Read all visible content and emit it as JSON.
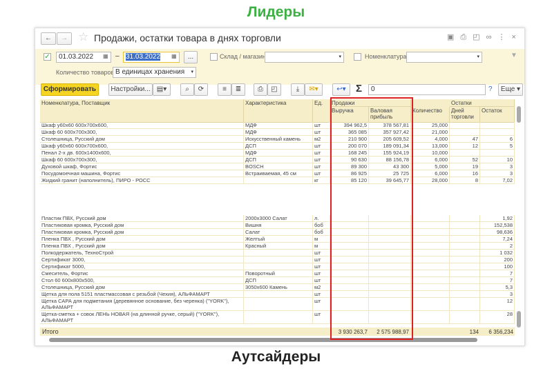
{
  "captions": {
    "top": "Лидеры",
    "bottom": "Аутсайдеры"
  },
  "window": {
    "title": "Продажи, остатки товара в днях торговли"
  },
  "filters": {
    "date_from": "01.03.2022",
    "date_sep": "–",
    "date_to": "31.03.2022",
    "dots": "...",
    "store_label": "Склад / магазин:",
    "nomen_label": "Номенклатура:",
    "qty_label": "Количество товаров:",
    "qty_value": "В единицах хранения"
  },
  "toolbar": {
    "generate": "Сформировать",
    "settings": "Настройки...",
    "sum_value": "0",
    "help": "?",
    "more": "Еще"
  },
  "headers": {
    "name": "Номенклатура, Поставщик",
    "char": "Характеристика",
    "unit": "Ед.",
    "sales": "Продажи",
    "revenue": "Выручка",
    "profit": "Валовая прибыль",
    "qty": "Количество",
    "stock": "Остатки",
    "days": "Дней торговли",
    "remain": "Остаток"
  },
  "leaders": [
    [
      "Шкаф у60х60 600х700х600,",
      "МДФ",
      "шт",
      "394 962,5",
      "378 567,81",
      "25,000",
      "",
      ""
    ],
    [
      "Шкаф 60 600х700х300,",
      "МДФ",
      "шт",
      "365 085",
      "357 927,42",
      "21,000",
      "",
      ""
    ],
    [
      "Столешница, Русский дом",
      "Искусственный камень",
      "м2",
      "210 900",
      "205 609,52",
      "4,000",
      "47",
      "6"
    ],
    [
      "Шкаф у60х60 600х700х600,",
      "ДСП",
      "шт",
      "200 070",
      "189 091,34",
      "13,000",
      "12",
      "5"
    ],
    [
      "Пенал 2-х дв. 600х1400х600,",
      "МДФ",
      "шт",
      "168 245",
      "155 924,19",
      "10,000",
      "",
      ""
    ],
    [
      "Шкаф 60 600х700х300,",
      "ДСП",
      "шт",
      "90 630",
      "88 156,78",
      "6,000",
      "52",
      "10"
    ],
    [
      "Духовой шкаф, Фортис",
      "BOSCH",
      "шт",
      "89 300",
      "43 300",
      "5,000",
      "19",
      "3"
    ],
    [
      "Посудомоечная машина, Фортис",
      "Встраиваемая, 45 см",
      "шт",
      "86 925",
      "25 725",
      "6,000",
      "16",
      "3"
    ],
    [
      "Жидкий гранит (наполнитель), ПИРО - РОСС",
      "",
      "кг",
      "85 120",
      "39 645,77",
      "28,000",
      "8",
      "7,02"
    ]
  ],
  "outsiders": [
    [
      "Пластик ПВХ, Русский дом",
      "2000х3000 Салат",
      "л.",
      "1,92"
    ],
    [
      "Пластиковая кромка, Русский дом",
      "Вишня",
      "боб",
      "152,538"
    ],
    [
      "Пластиковая кромка, Русский дом",
      "Салат",
      "боб",
      "98,636"
    ],
    [
      "Пленка ПВХ , Русский дом",
      "Желтый",
      "м",
      "7,24"
    ],
    [
      "Пленка ПВХ , Русский дом",
      "Красный",
      "м",
      "2"
    ],
    [
      "Полкодержатель, ТехноСтрой",
      "",
      "шт",
      "1 032"
    ],
    [
      "Сертификат 3000,",
      "",
      "шт",
      "200"
    ],
    [
      "Сертификат 5000,",
      "",
      "шт",
      "100"
    ],
    [
      "Смеситель, Фортис",
      "Поворотный",
      "шт",
      "7"
    ],
    [
      "Стол 60 600х800х500,",
      "ДСП",
      "шт",
      "7"
    ],
    [
      "Столешница, Русский дом",
      "3050х600 Камень",
      "м2",
      "5,3"
    ],
    [
      "Щетка для пола 5151 пластмассовая с резьбой (Чехия), АЛЬФАМАРТ",
      "",
      "шт",
      "3"
    ],
    [
      "Щетка САРА для подметания (деревянное основание, без черенка) (\"YORK\"), АЛЬФАМАРТ",
      "",
      "шт",
      "12"
    ],
    [
      "Щетка-сметка + совок ЛЕНЬ НОВАЯ (на длинной ручке, серый) (\"YORK\"), АЛЬФАМАРТ",
      "",
      "шт",
      "28"
    ]
  ],
  "totals": {
    "label": "Итого",
    "revenue": "3 930 263,7",
    "profit": "2 575 988,97",
    "days": "134",
    "remain": "6 356,234"
  },
  "colors": {
    "leaders": "#3cb043",
    "highlight": "#e02020",
    "generate": "#f5d422",
    "filter_bg": "#fbf5d9"
  }
}
